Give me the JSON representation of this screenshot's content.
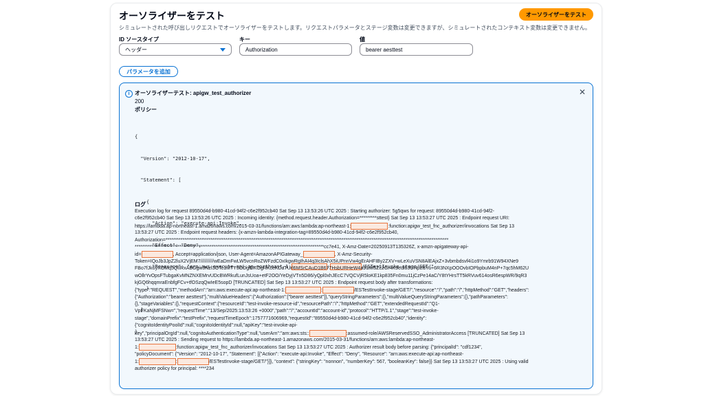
{
  "header": {
    "title": "オーソライザーをテスト",
    "description": "シミュレートされた呼び出しリクエストでオーソライザーをテストします。リクエストパラメータとステージ変数は変更できますが、シミュレートされたコンテキスト変数は変更できません。",
    "test_button": "オーソライザーをテスト"
  },
  "form": {
    "identity_source_type": {
      "label": "ID ソースタイプ",
      "value": "ヘッダー"
    },
    "key": {
      "label": "キー",
      "value": "Authorization"
    },
    "value": {
      "label": "値",
      "value": "bearer aesttest"
    },
    "add_param_button": "パラメータを追加"
  },
  "result": {
    "title": "オーソライザーテスト: apigw_test_authorizer",
    "status": "200",
    "policy_label": "ポリシー",
    "policy_lines": [
      "{",
      "  \"Version\": \"2012-10-17\",",
      "  \"Statement\": [",
      "    {",
      "      \"Action\": \"execute-api:Invoke\",",
      "      \"Effect\": \"Deny\",",
      "      \"Resource\": \"arn:aws:execute-api:ap-northeast-1:",
      ":",
      "/ESTestInvoke-stage/GET/\"",
      "    }",
      "  ]",
      "}"
    ],
    "log_label": "ログ",
    "log": {
      "l1": "Execution log for request 89550d4d-b980-41cd-94f2-c6e2f952cb40 Sat Sep 13 13:53:26 UTC 2025 : Starting authorizer: 5g5qws for request: 89550d4d-b980-41cd-94f2-",
      "l2": "c6e2f952cb40 Sat Sep 13 13:53:26 UTC 2025 : Incoming identity: {method.request.header.Authorization=*********sttest} Sat Sep 13 13:53:27 UTC 2025 : Endpoint request URI:",
      "l3a": "https://lambda.ap-northeast-1.amazonaws.com/2015-03-31/functions/arn:aws:lambda:ap-northeast-1:",
      "l3b": ":function:apigw_test_fnc_authorizer/invocations Sat Sep 13",
      "l4": "13:53:27 UTC 2025 : Endpoint request headers: {x-amzn-lambda-integration-tag=89550d4d-b980-41cd-94f2-c6e2f952cb40,",
      "l5": "Authorization=*******************************************************************************************************************************************************",
      "l6": "*****************************************************************************************************cc7e41, X-Amz-Date=20250913T135326Z, x-amzn-apigateway-api-",
      "l7a": "id=",
      "l7b": ", Accept=application/json, User-Agent=AmazonAPIGateway_",
      "l7c": ", X-Amz-Security-",
      "l8": "Token=IQoJb3JpZ2luX2VjEM7//////////wEaDmFwLW5vcnRoZWFzdC0xIkgwRgIhAI4q3IclsAhX5iUPnnVw4gErAHFIBy2ZXV+wLeXuVSN8AlEAjxZ+3vbmbdsvf4i1o9Ymrb91W94XNe9",
      "l9": "FBo7fJk6yXOMq5QIIRxABGgw3NzI3OTc1MTY3ODgiDKOgRKceKDaTUrl6MSrCAuD1B677HsbURHeW4a91iM5Zc2Gr4K9edl63UHpEdYu+6R3NXpOOOvbIOPbpbuM4nP+7qc5hM62U",
      "l10": "wOllrYvOpsFTubgaKvMNZNXEMrvUDcBWRkufLunJsUoa+etF2OO/YeDyjVTn5D86/yQpl0xhJEcC7VQCVjR5loKE1kp835Fn0mu11jCzPe14aC/Y8tYHrsTT5kRVuv614osR6espWR/9qR3",
      "l11": "kjGQ6hqqmraEnbfgFCv+tfOSzqQwIeE5sopD [TRUNCATED] Sat Sep 13 13:53:27 UTC 2025 : Endpoint request body after transformations:",
      "l12a": "{\"type\":\"REQUEST\",\"methodArn\":\"arn:aws:execute-api:ap-northeast-1:",
      "l12b": ":",
      "l12c": "/ESTestInvoke-stage/GET/\",\"resource\":\"/\",\"path\":\"/\",\"httpMethod\":\"GET\",\"headers\":",
      "l13": "{\"Authorization\":\"bearer aesttest\"},\"multiValueHeaders\":{\"Authorization\":[\"bearer aesttest\"]},\"queryStringParameters\":{},\"multiValueQueryStringParameters\":{},\"pathParameters\":",
      "l14": "{},\"stageVariables\":{},\"requestContext\":{\"resourceId\":\"test-invoke-resource-id\",\"resourcePath\":\"/\",\"httpMethod\":\"GET\",\"extendedRequestId\":\"Q1-",
      "l15": "VpFKaNjMFSNw=\",\"requestTime\":\"13/Sep/2025:13:53:26 +0000\",\"path\":\"/\",\"accountId\":\"account-id\",\"protocol\":\"HTTP/1.1\",\"stage\":\"test-invoke-",
      "l16": "stage\",\"domainPrefix\":\"testPrefix\",\"requestTimeEpoch\":1757771606969,\"requestId\":\"89550d4d-b980-41cd-94f2-c6e2f952cb40\",\"identity\":",
      "l17": "{\"cognitoIdentityPoolId\":null,\"cognitoIdentityId\":null,\"apiKey\":\"test-invoke-api-",
      "l18a": "key\",\"principalOrgId\":null,\"cognitoAuthenticationType\":null,\"userArn\":\"arn:aws:sts::",
      "l18b": ":assumed-role/AWSReservedSSO_AdministratorAccess [TRUNCATED] Sat Sep 13",
      "l19": "13:53:27 UTC 2025 : Sending request to https://lambda.ap-northeast-1.amazonaws.com/2015-03-31/functions/arn:aws:lambda:ap-northeast-",
      "l20a": "1:",
      "l20b": ":function:apigw_test_fnc_authorizer/invocations Sat Sep 13 13:53:27 UTC 2025 : Authorizer result body before parsing: {\"principalId\": \"cdf1234\",",
      "l21": "\"policyDocument\": {\"Version\": \"2012-10-17\", \"Statement\": [{\"Action\": \"execute-api:Invoke\", \"Effect\": \"Deny\", \"Resource\": \"arn:aws:execute-api:ap-northeast-",
      "l22a": "1:",
      "l22b": ":",
      "l22c": "/ESTestInvoke-stage/GET/\"}]}, \"context\": {\"stringKey\": \"nonnon\", \"numberKey\": 567, \"booleanKey\": false}} Sat Sep 13 13:53:27 UTC 2025 : Using valid",
      "l23": "authorizer policy for principal: ****234"
    }
  }
}
